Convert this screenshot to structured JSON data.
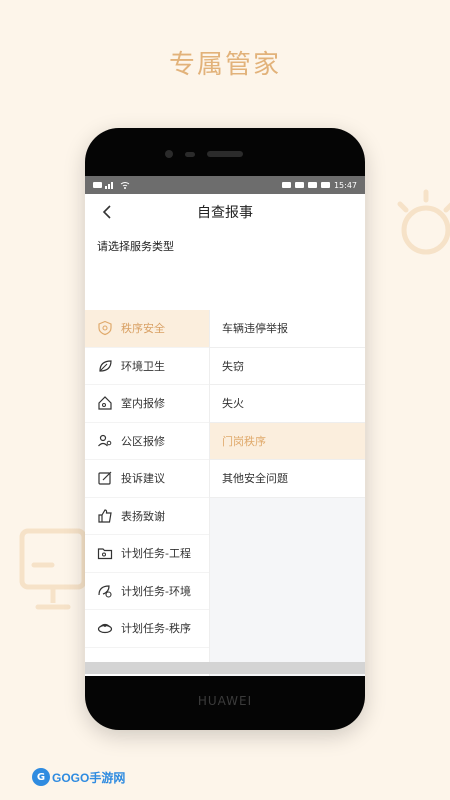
{
  "promo": {
    "title": "专属管家"
  },
  "device": {
    "brand": "HUAWEI"
  },
  "statusbar": {
    "time": "15:47"
  },
  "header": {
    "title": "自查报事"
  },
  "section": {
    "label": "请选择服务类型"
  },
  "categories": [
    {
      "label": "秩序安全",
      "icon": "shield-icon",
      "active": true
    },
    {
      "label": "环境卫生",
      "icon": "leaf-icon",
      "active": false
    },
    {
      "label": "室内报修",
      "icon": "house-icon",
      "active": false
    },
    {
      "label": "公区报修",
      "icon": "people-icon",
      "active": false
    },
    {
      "label": "投诉建议",
      "icon": "edit-icon",
      "active": false
    },
    {
      "label": "表扬致谢",
      "icon": "thumbs-up-icon",
      "active": false
    },
    {
      "label": "计划任务-工程",
      "icon": "folder-icon",
      "active": false
    },
    {
      "label": "计划任务-环境",
      "icon": "leaf-gear-icon",
      "active": false
    },
    {
      "label": "计划任务-秩序",
      "icon": "cap-icon",
      "active": false
    }
  ],
  "subcategories": [
    {
      "label": "车辆违停举报",
      "active": false
    },
    {
      "label": "失窃",
      "active": false
    },
    {
      "label": "失火",
      "active": false
    },
    {
      "label": "门岗秩序",
      "active": true
    },
    {
      "label": "其他安全问题",
      "active": false
    }
  ],
  "watermark": {
    "text": "GOGO手游网"
  },
  "colors": {
    "accent": "#e0aa6c",
    "active_bg": "#fbeedd",
    "page_bg": "#fdf5ea"
  }
}
